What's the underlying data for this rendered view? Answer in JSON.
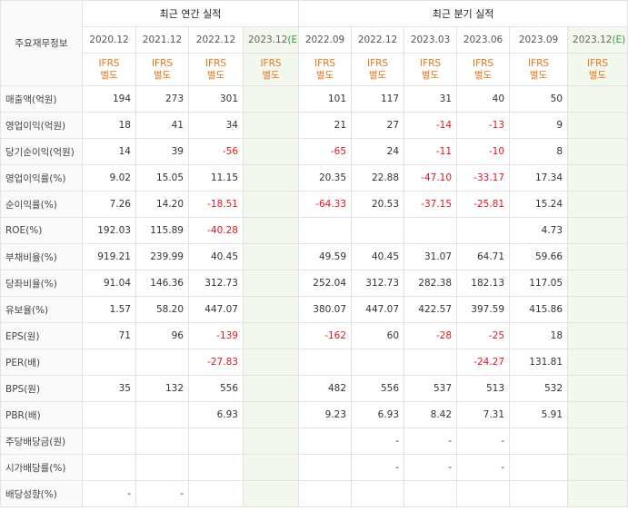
{
  "table": {
    "corner_label": "주요재무정보",
    "annual_group": "최근 연간 실적",
    "quarter_group": "최근 분기 실적",
    "annual_periods": [
      "2020.12",
      "2021.12",
      "2022.12"
    ],
    "annual_estimate": {
      "period": "2023.12",
      "mark": "(E)"
    },
    "quarter_periods": [
      "2022.09",
      "2022.12",
      "2023.03",
      "2023.06",
      "2023.09"
    ],
    "quarter_estimate": {
      "period": "2023.12",
      "mark": "(E)"
    },
    "ifrs_line1": "IFRS",
    "ifrs_line2": "별도",
    "rows": [
      {
        "label": "매출액(억원)",
        "annual": [
          "194",
          "273",
          "301"
        ],
        "annual_est": "",
        "quarter": [
          "101",
          "117",
          "31",
          "40",
          "50"
        ],
        "quarter_est": ""
      },
      {
        "label": "영업이익(억원)",
        "annual": [
          "18",
          "41",
          "34"
        ],
        "annual_est": "",
        "quarter": [
          "21",
          "27",
          "-14",
          "-13",
          "9"
        ],
        "quarter_est": ""
      },
      {
        "label": "당기순이익(억원)",
        "annual": [
          "14",
          "39",
          "-56"
        ],
        "annual_est": "",
        "quarter": [
          "-65",
          "24",
          "-11",
          "-10",
          "8"
        ],
        "quarter_est": ""
      },
      {
        "label": "영업이익률(%)",
        "annual": [
          "9.02",
          "15.05",
          "11.15"
        ],
        "annual_est": "",
        "quarter": [
          "20.35",
          "22.88",
          "-47.10",
          "-33.17",
          "17.34"
        ],
        "quarter_est": ""
      },
      {
        "label": "순이익률(%)",
        "annual": [
          "7.26",
          "14.20",
          "-18.51"
        ],
        "annual_est": "",
        "quarter": [
          "-64.33",
          "20.53",
          "-37.15",
          "-25.81",
          "15.24"
        ],
        "quarter_est": ""
      },
      {
        "label": "ROE(%)",
        "annual": [
          "192.03",
          "115.89",
          "-40.28"
        ],
        "annual_est": "",
        "quarter": [
          "",
          "",
          "",
          "",
          "4.73"
        ],
        "quarter_est": ""
      },
      {
        "label": "부채비율(%)",
        "annual": [
          "919.21",
          "239.99",
          "40.45"
        ],
        "annual_est": "",
        "quarter": [
          "49.59",
          "40.45",
          "31.07",
          "64.71",
          "59.66"
        ],
        "quarter_est": ""
      },
      {
        "label": "당좌비율(%)",
        "annual": [
          "91.04",
          "146.36",
          "312.73"
        ],
        "annual_est": "",
        "quarter": [
          "252.04",
          "312.73",
          "282.38",
          "182.13",
          "117.05"
        ],
        "quarter_est": ""
      },
      {
        "label": "유보율(%)",
        "annual": [
          "1.57",
          "58.20",
          "447.07"
        ],
        "annual_est": "",
        "quarter": [
          "380.07",
          "447.07",
          "422.57",
          "397.59",
          "415.86"
        ],
        "quarter_est": ""
      },
      {
        "label": "EPS(원)",
        "annual": [
          "71",
          "96",
          "-139"
        ],
        "annual_est": "",
        "quarter": [
          "-162",
          "60",
          "-28",
          "-25",
          "18"
        ],
        "quarter_est": ""
      },
      {
        "label": "PER(배)",
        "annual": [
          "",
          "",
          "-27.83"
        ],
        "annual_est": "",
        "quarter": [
          "",
          "",
          "",
          "-24.27",
          "131.81"
        ],
        "quarter_est": ""
      },
      {
        "label": "BPS(원)",
        "annual": [
          "35",
          "132",
          "556"
        ],
        "annual_est": "",
        "quarter": [
          "482",
          "556",
          "537",
          "513",
          "532"
        ],
        "quarter_est": ""
      },
      {
        "label": "PBR(배)",
        "annual": [
          "",
          "",
          "6.93"
        ],
        "annual_est": "",
        "quarter": [
          "9.23",
          "6.93",
          "8.42",
          "7.31",
          "5.91"
        ],
        "quarter_est": ""
      },
      {
        "label": "주당배당금(원)",
        "annual": [
          "",
          "",
          ""
        ],
        "annual_est": "",
        "quarter": [
          "",
          "-",
          "-",
          "-",
          ""
        ],
        "quarter_est": ""
      },
      {
        "label": "시가배당률(%)",
        "annual": [
          "",
          "",
          ""
        ],
        "annual_est": "",
        "quarter": [
          "",
          "-",
          "-",
          "-",
          ""
        ],
        "quarter_est": ""
      },
      {
        "label": "배당성향(%)",
        "annual": [
          "-",
          "-",
          ""
        ],
        "annual_est": "",
        "quarter": [
          "",
          "",
          "",
          "",
          ""
        ],
        "quarter_est": ""
      }
    ],
    "colors": {
      "negative": "#e0181e",
      "ifrs": "#e8751a",
      "estimate_bg": "#f3f8ee",
      "estimate_mark": "#2e9e3a"
    }
  }
}
